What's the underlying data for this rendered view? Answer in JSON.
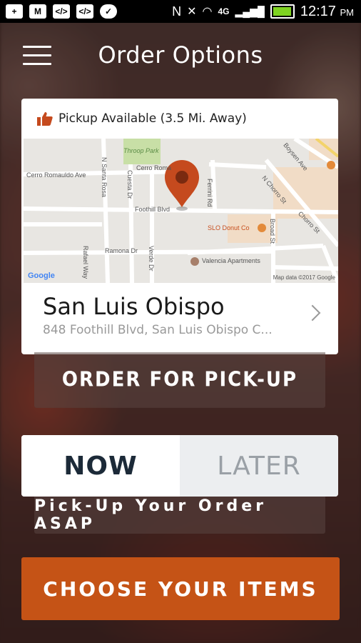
{
  "status_bar": {
    "time": "12:17",
    "ampm": "PM",
    "network": "4G"
  },
  "header": {
    "title": "Order Options"
  },
  "location_card": {
    "pickup_status": "Pickup Available (3.5 Mi. Away)",
    "name": "San Luis Obispo",
    "address": "848 Foothill Blvd, San Luis Obispo C...",
    "map": {
      "labels": {
        "throop_park": "Throop Park",
        "cerro_romauldo_ave": "Cerro Romauldo Ave",
        "cerro_romauldo_short": "Cerro Roma",
        "foothill_blvd": "Foothill Blvd",
        "ferrini_rd": "Ferrini Rd",
        "n_chorro_st": "N Chorro St",
        "chorro_st": "Chorro St",
        "boysen_ave": "Boysen Ave",
        "slo_donut": "SLO Donut Co",
        "ramona_dr": "Ramona Dr",
        "valencia": "Valencia Apartments",
        "broad_st": "Broad St",
        "n_santa_rosa": "N Santa Rosa",
        "cuesta_dr": "Cuesta Dr",
        "rafael_way": "Rafael Way",
        "verde_dr": "Verde Dr",
        "google": "Google",
        "copyright": "Map data ©2017 Google"
      },
      "pin_color": "#c54a1e"
    }
  },
  "pickup_button": {
    "label": "ORDER FOR PICK-UP"
  },
  "timing": {
    "now_label": "NOW",
    "later_label": "LATER",
    "selected": "now",
    "note": "Pick-Up Your Order ASAP"
  },
  "choose_button": {
    "label": "CHOOSE YOUR ITEMS"
  },
  "colors": {
    "accent": "#c55316",
    "thumb": "#c54a1e"
  }
}
